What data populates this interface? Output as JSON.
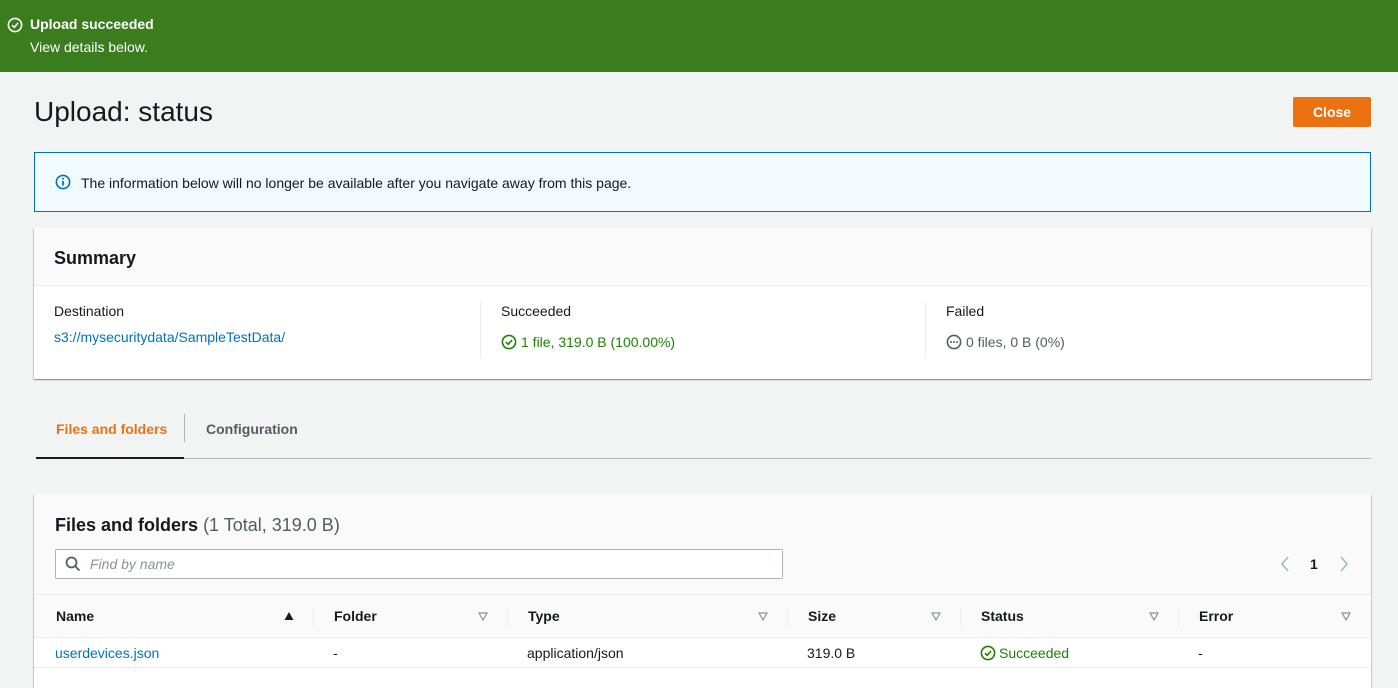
{
  "flash": {
    "title": "Upload succeeded",
    "subtitle": "View details below.",
    "icon": "check-circle-icon",
    "color": "#3b7d1e"
  },
  "page": {
    "title": "Upload: status",
    "close_label": "Close",
    "accent": "#ec7211"
  },
  "info": {
    "text": "The information below will no longer be available after you navigate away from this page.",
    "icon": "info-icon"
  },
  "summary": {
    "title": "Summary",
    "destination_label": "Destination",
    "destination_value": "s3://mysecuritydata/SampleTestData/",
    "succeeded_label": "Succeeded",
    "succeeded_value": "1 file, 319.0 B (100.00%)",
    "failed_label": "Failed",
    "failed_value": "0 files, 0 B (0%)"
  },
  "tabs": [
    {
      "label": "Files and folders",
      "active": true
    },
    {
      "label": "Configuration",
      "active": false
    }
  ],
  "files": {
    "title": "Files and folders",
    "count": "(1 Total, 319.0 B)",
    "search_placeholder": "Find by name",
    "page_number": "1",
    "columns": [
      "Name",
      "Folder",
      "Type",
      "Size",
      "Status",
      "Error"
    ],
    "rows": [
      {
        "name": "userdevices.json",
        "folder": "-",
        "type": "application/json",
        "size": "319.0 B",
        "status": "Succeeded",
        "error": "-"
      }
    ]
  }
}
